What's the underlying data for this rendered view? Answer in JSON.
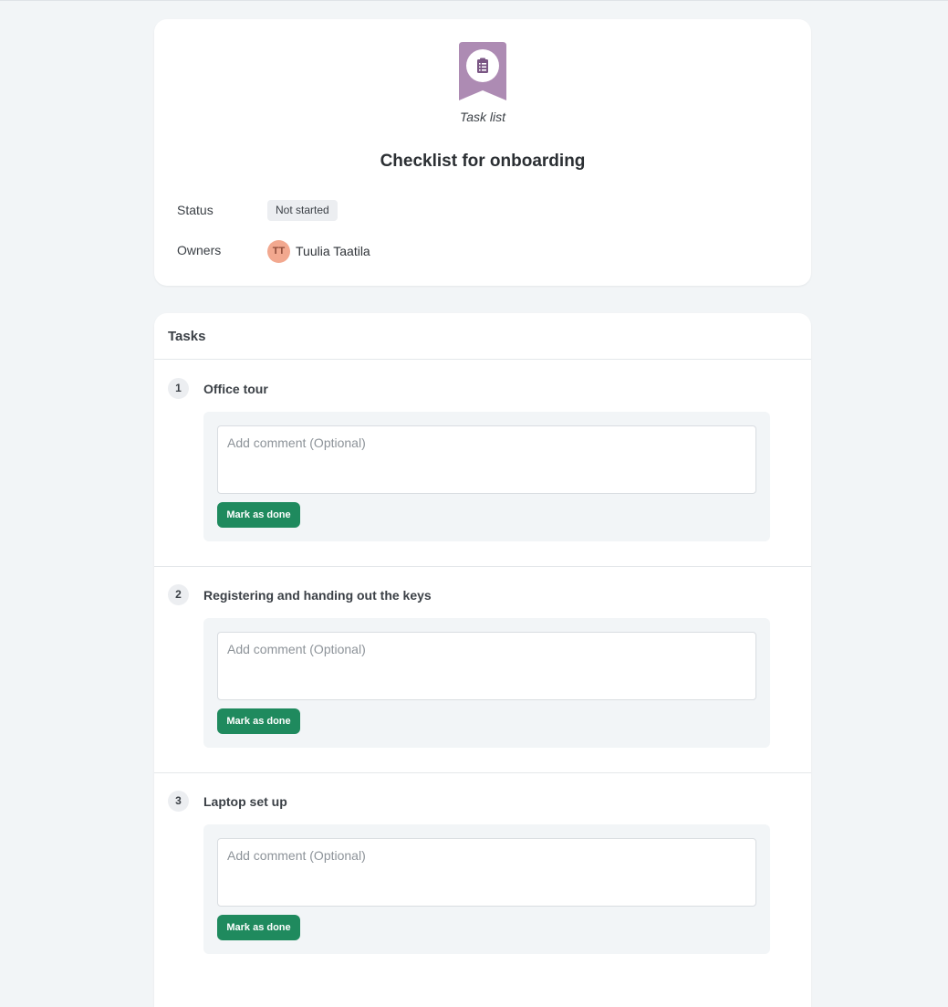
{
  "header": {
    "type_label": "Task list",
    "icon": "clipboard-list-icon",
    "icon_color": "#ad8bb3",
    "title": "Checklist for onboarding",
    "status_label": "Status",
    "status_value": "Not started",
    "owners_label": "Owners",
    "owner": {
      "initials": "TT",
      "name": "Tuulia Taatila",
      "avatar_color": "#f2a88f"
    }
  },
  "tasks": {
    "title": "Tasks",
    "items": [
      {
        "number": "1",
        "title": "Office tour",
        "placeholder": "Add comment (Optional)",
        "button": "Mark as done"
      },
      {
        "number": "2",
        "title": "Registering and handing out the keys",
        "placeholder": "Add comment (Optional)",
        "button": "Mark as done"
      },
      {
        "number": "3",
        "title": "Laptop set up",
        "placeholder": "Add comment (Optional)",
        "button": "Mark as done"
      }
    ]
  },
  "colors": {
    "primary_button": "#1f8a5e",
    "background": "#f2f5f7"
  }
}
